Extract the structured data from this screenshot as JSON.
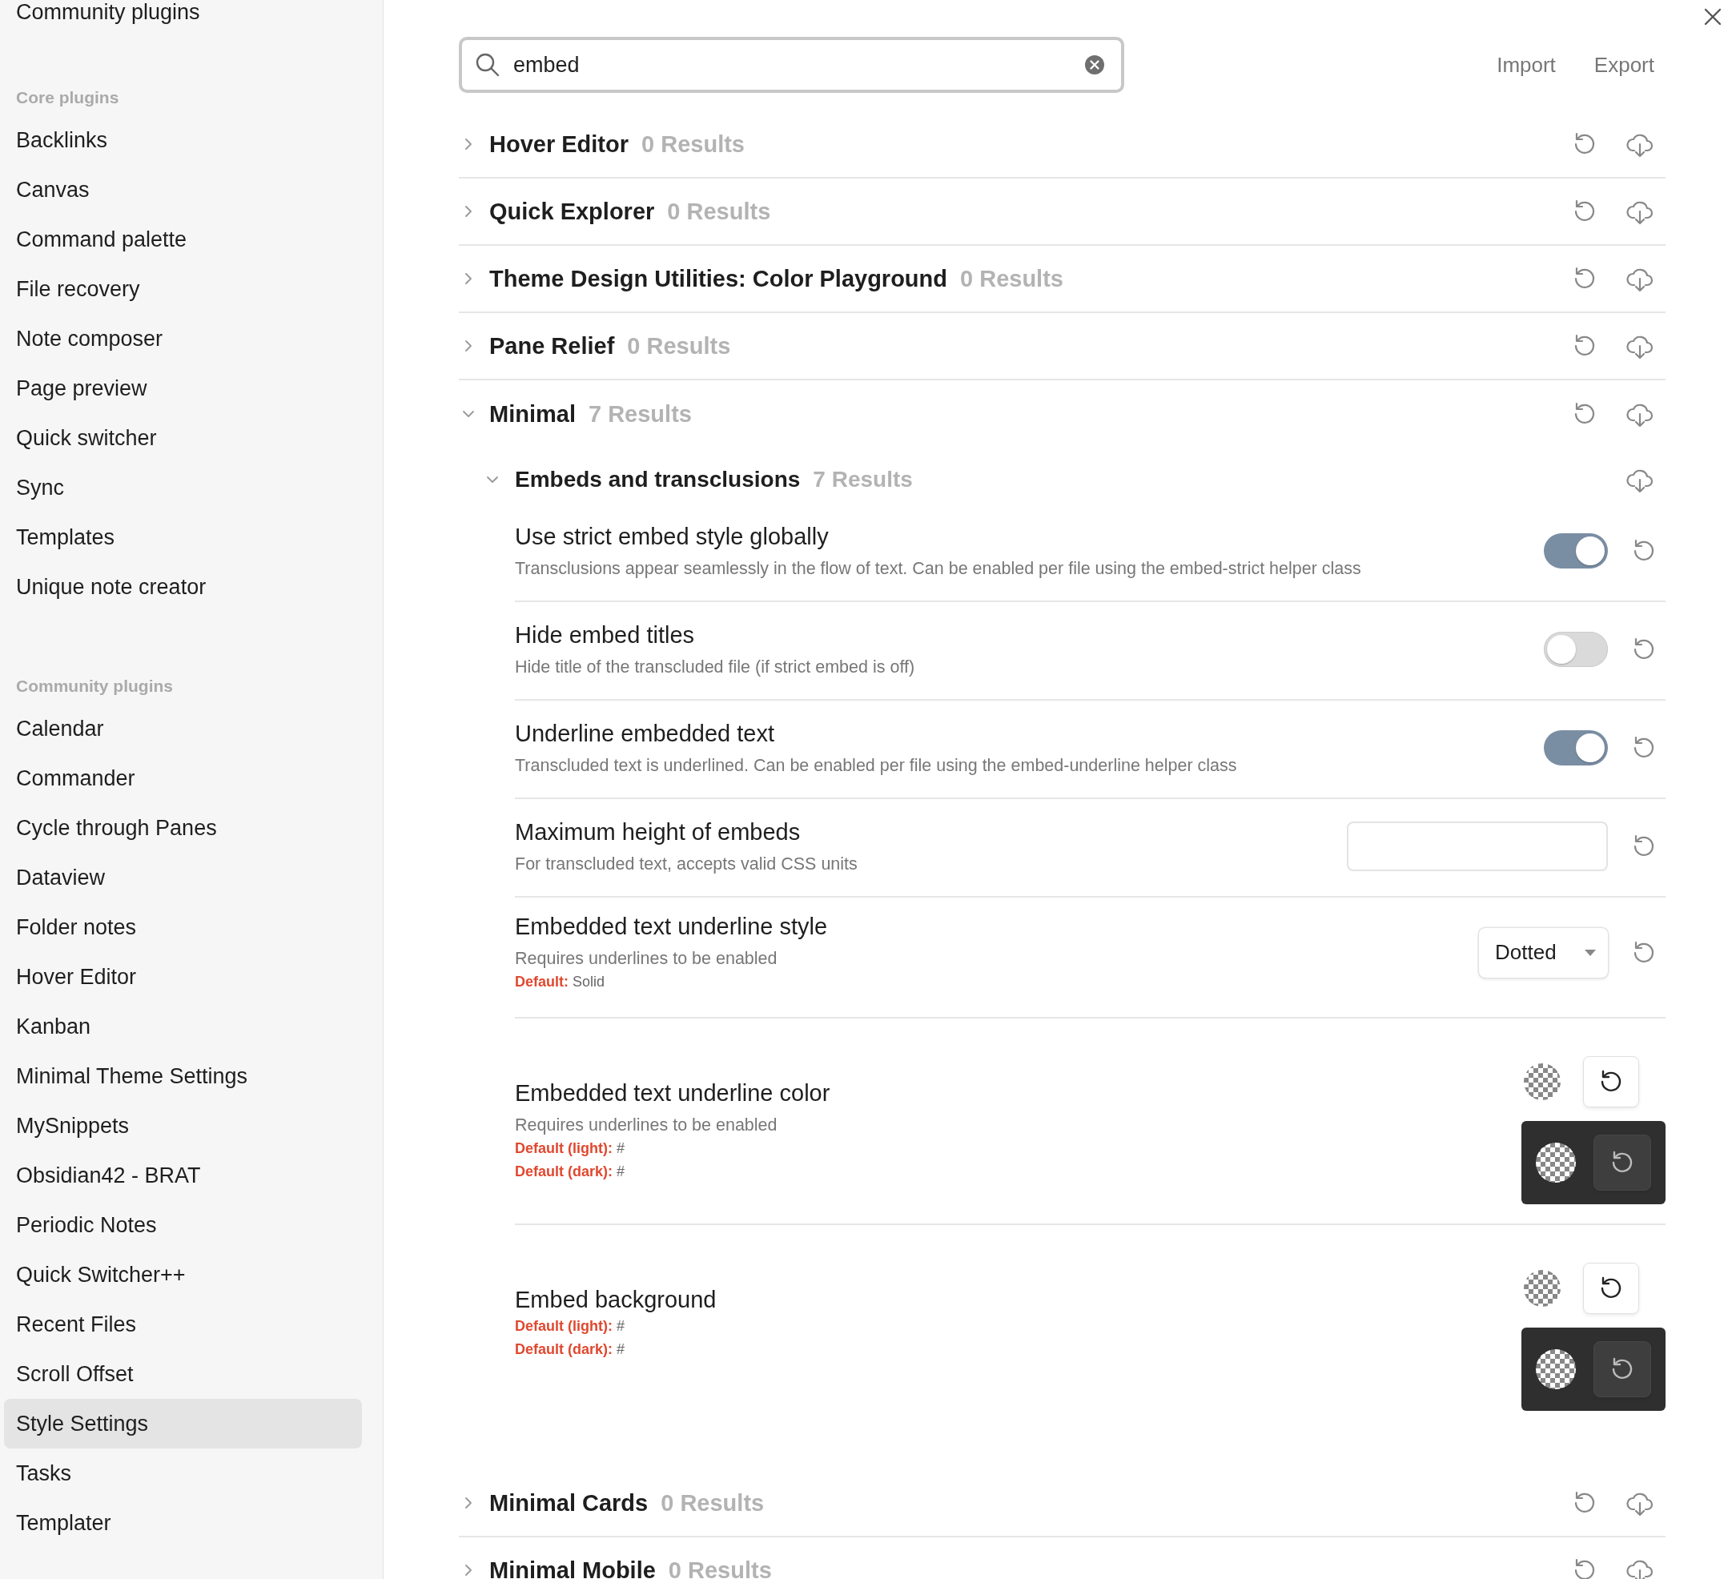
{
  "sidebar": {
    "top_item": "Community plugins",
    "groups": [
      {
        "heading": "Core plugins",
        "items": [
          {
            "label": "Backlinks",
            "selected": false
          },
          {
            "label": "Canvas",
            "selected": false
          },
          {
            "label": "Command palette",
            "selected": false
          },
          {
            "label": "File recovery",
            "selected": false
          },
          {
            "label": "Note composer",
            "selected": false
          },
          {
            "label": "Page preview",
            "selected": false
          },
          {
            "label": "Quick switcher",
            "selected": false
          },
          {
            "label": "Sync",
            "selected": false
          },
          {
            "label": "Templates",
            "selected": false
          },
          {
            "label": "Unique note creator",
            "selected": false
          }
        ]
      },
      {
        "heading": "Community plugins",
        "items": [
          {
            "label": "Calendar",
            "selected": false
          },
          {
            "label": "Commander",
            "selected": false
          },
          {
            "label": "Cycle through Panes",
            "selected": false
          },
          {
            "label": "Dataview",
            "selected": false
          },
          {
            "label": "Folder notes",
            "selected": false
          },
          {
            "label": "Hover Editor",
            "selected": false
          },
          {
            "label": "Kanban",
            "selected": false
          },
          {
            "label": "Minimal Theme Settings",
            "selected": false
          },
          {
            "label": "MySnippets",
            "selected": false
          },
          {
            "label": "Obsidian42 - BRAT",
            "selected": false
          },
          {
            "label": "Periodic Notes",
            "selected": false
          },
          {
            "label": "Quick Switcher++",
            "selected": false
          },
          {
            "label": "Recent Files",
            "selected": false
          },
          {
            "label": "Scroll Offset",
            "selected": false
          },
          {
            "label": "Style Settings",
            "selected": true
          },
          {
            "label": "Tasks",
            "selected": false
          },
          {
            "label": "Templater",
            "selected": false
          }
        ]
      }
    ]
  },
  "search": {
    "value": "embed"
  },
  "header_actions": [
    "Import",
    "Export"
  ],
  "sections": [
    {
      "title": "Hover Editor",
      "results": "0 Results",
      "expanded": false
    },
    {
      "title": "Quick Explorer",
      "results": "0 Results",
      "expanded": false
    },
    {
      "title": "Theme Design Utilities: Color Playground",
      "results": "0 Results",
      "expanded": false
    },
    {
      "title": "Pane Relief",
      "results": "0 Results",
      "expanded": false
    },
    {
      "title": "Minimal",
      "results": "7 Results",
      "expanded": true,
      "subsections": [
        {
          "title": "Embeds and transclusions",
          "results": "7 Results",
          "expanded": true,
          "settings": [
            {
              "kind": "toggle",
              "name": "Use strict embed style globally",
              "description": "Transclusions appear seamlessly in the flow of text. Can be enabled per file using the embed-strict helper class",
              "on": true
            },
            {
              "kind": "toggle",
              "name": "Hide embed titles",
              "description": "Hide title of the transcluded file (if strict embed is off)",
              "on": false
            },
            {
              "kind": "toggle",
              "name": "Underline embedded text",
              "description": "Transcluded text is underlined. Can be enabled per file using the embed-underline helper class",
              "on": true
            },
            {
              "kind": "text",
              "name": "Maximum height of embeds",
              "description": "For transcluded text, accepts valid CSS units"
            },
            {
              "kind": "dropdown",
              "name": "Embedded text underline style",
              "description": "Requires underlines to be enabled",
              "value": "Dotted",
              "defaults": [
                {
                  "label": "Default:",
                  "value": "Solid"
                }
              ]
            },
            {
              "kind": "color",
              "name": "Embedded text underline color",
              "description": "Requires underlines to be enabled",
              "defaults": [
                {
                  "label": "Default (light):",
                  "value": "#"
                },
                {
                  "label": "Default (dark):",
                  "value": "#"
                }
              ]
            },
            {
              "kind": "color",
              "name": "Embed background",
              "defaults": [
                {
                  "label": "Default (light):",
                  "value": "#"
                },
                {
                  "label": "Default (dark):",
                  "value": "#"
                }
              ]
            }
          ]
        }
      ]
    },
    {
      "title": "Minimal Cards",
      "results": "0 Results",
      "expanded": false
    },
    {
      "title": "Minimal Mobile",
      "results": "0 Results",
      "expanded": false
    }
  ]
}
